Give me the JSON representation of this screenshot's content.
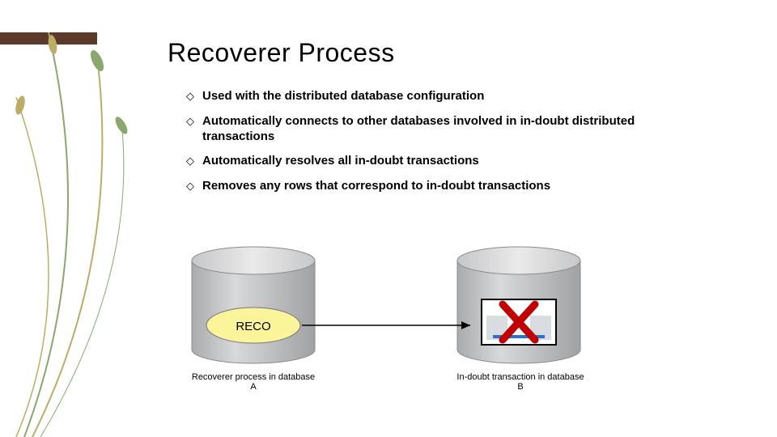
{
  "title": "Recoverer Process",
  "bullets": {
    "b1": "Used with the distributed database configuration",
    "b2": "Automatically connects to other databases involved in in-doubt distributed transactions",
    "b3": "Automatically resolves all in-doubt transactions",
    "b4": "Removes any rows that correspond to in-doubt transactions"
  },
  "diagram": {
    "reco_label": "RECO",
    "caption_left": "Recoverer process in database A",
    "caption_right": "In-doubt transaction in database B"
  },
  "colors": {
    "accent": "#5b3a29",
    "cylinder": "#c2c3c5",
    "ellipse_fill": "#fcf49a",
    "arrow": "#000000",
    "leaf1": "#8aa86e",
    "leaf2": "#bcad66"
  }
}
